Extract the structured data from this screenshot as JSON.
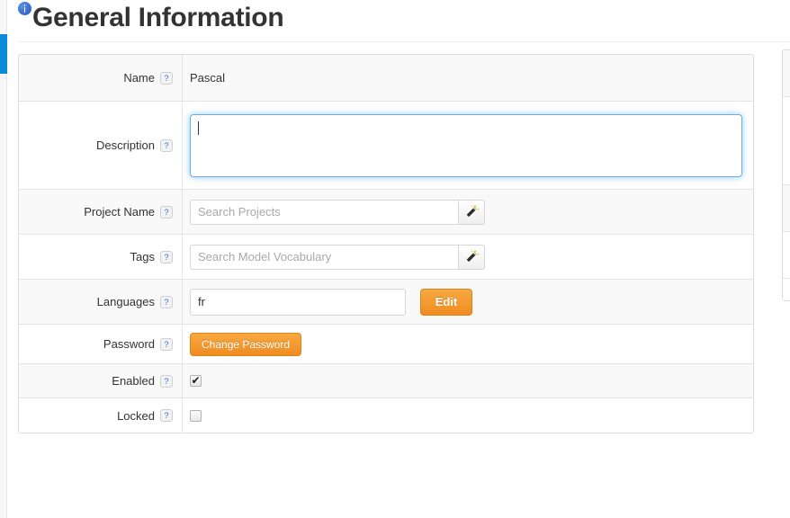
{
  "header": {
    "title": "General Information",
    "info_icon": "info-circle-icon"
  },
  "scrollbar": {
    "name": "page-vertical-scrollbar",
    "thumb_color": "#0d8bd9"
  },
  "colors": {
    "accent_orange": "#ef8c21",
    "focus_blue": "#66afe9",
    "scroll_blue": "#0d8bd9",
    "row_shade": "#f9f9f9",
    "border": "#dddddd"
  },
  "help_glyph": "?",
  "form": {
    "rows": [
      {
        "id": "name",
        "label": "Name",
        "help": "?",
        "type": "static",
        "value": "Pascal"
      },
      {
        "id": "description",
        "label": "Description",
        "help": "?",
        "type": "textarea",
        "value": "",
        "placeholder": "",
        "focused": true
      },
      {
        "id": "project_name",
        "label": "Project Name",
        "help": "?",
        "type": "input-wand",
        "value": "",
        "placeholder": "Search Projects",
        "wand_icon": "magic-wand-icon"
      },
      {
        "id": "tags",
        "label": "Tags",
        "help": "?",
        "type": "input-wand",
        "value": "",
        "placeholder": "Search Model Vocabulary",
        "wand_icon": "magic-wand-icon"
      },
      {
        "id": "languages",
        "label": "Languages",
        "help": "?",
        "type": "input-button",
        "value": "fr",
        "placeholder": "",
        "button_label": "Edit"
      },
      {
        "id": "password",
        "label": "Password",
        "help": "?",
        "type": "button",
        "button_label": "Change Password"
      },
      {
        "id": "enabled",
        "label": "Enabled",
        "help": "?",
        "type": "checkbox",
        "checked": true
      },
      {
        "id": "locked",
        "label": "Locked",
        "help": "?",
        "type": "checkbox",
        "checked": false
      }
    ]
  }
}
